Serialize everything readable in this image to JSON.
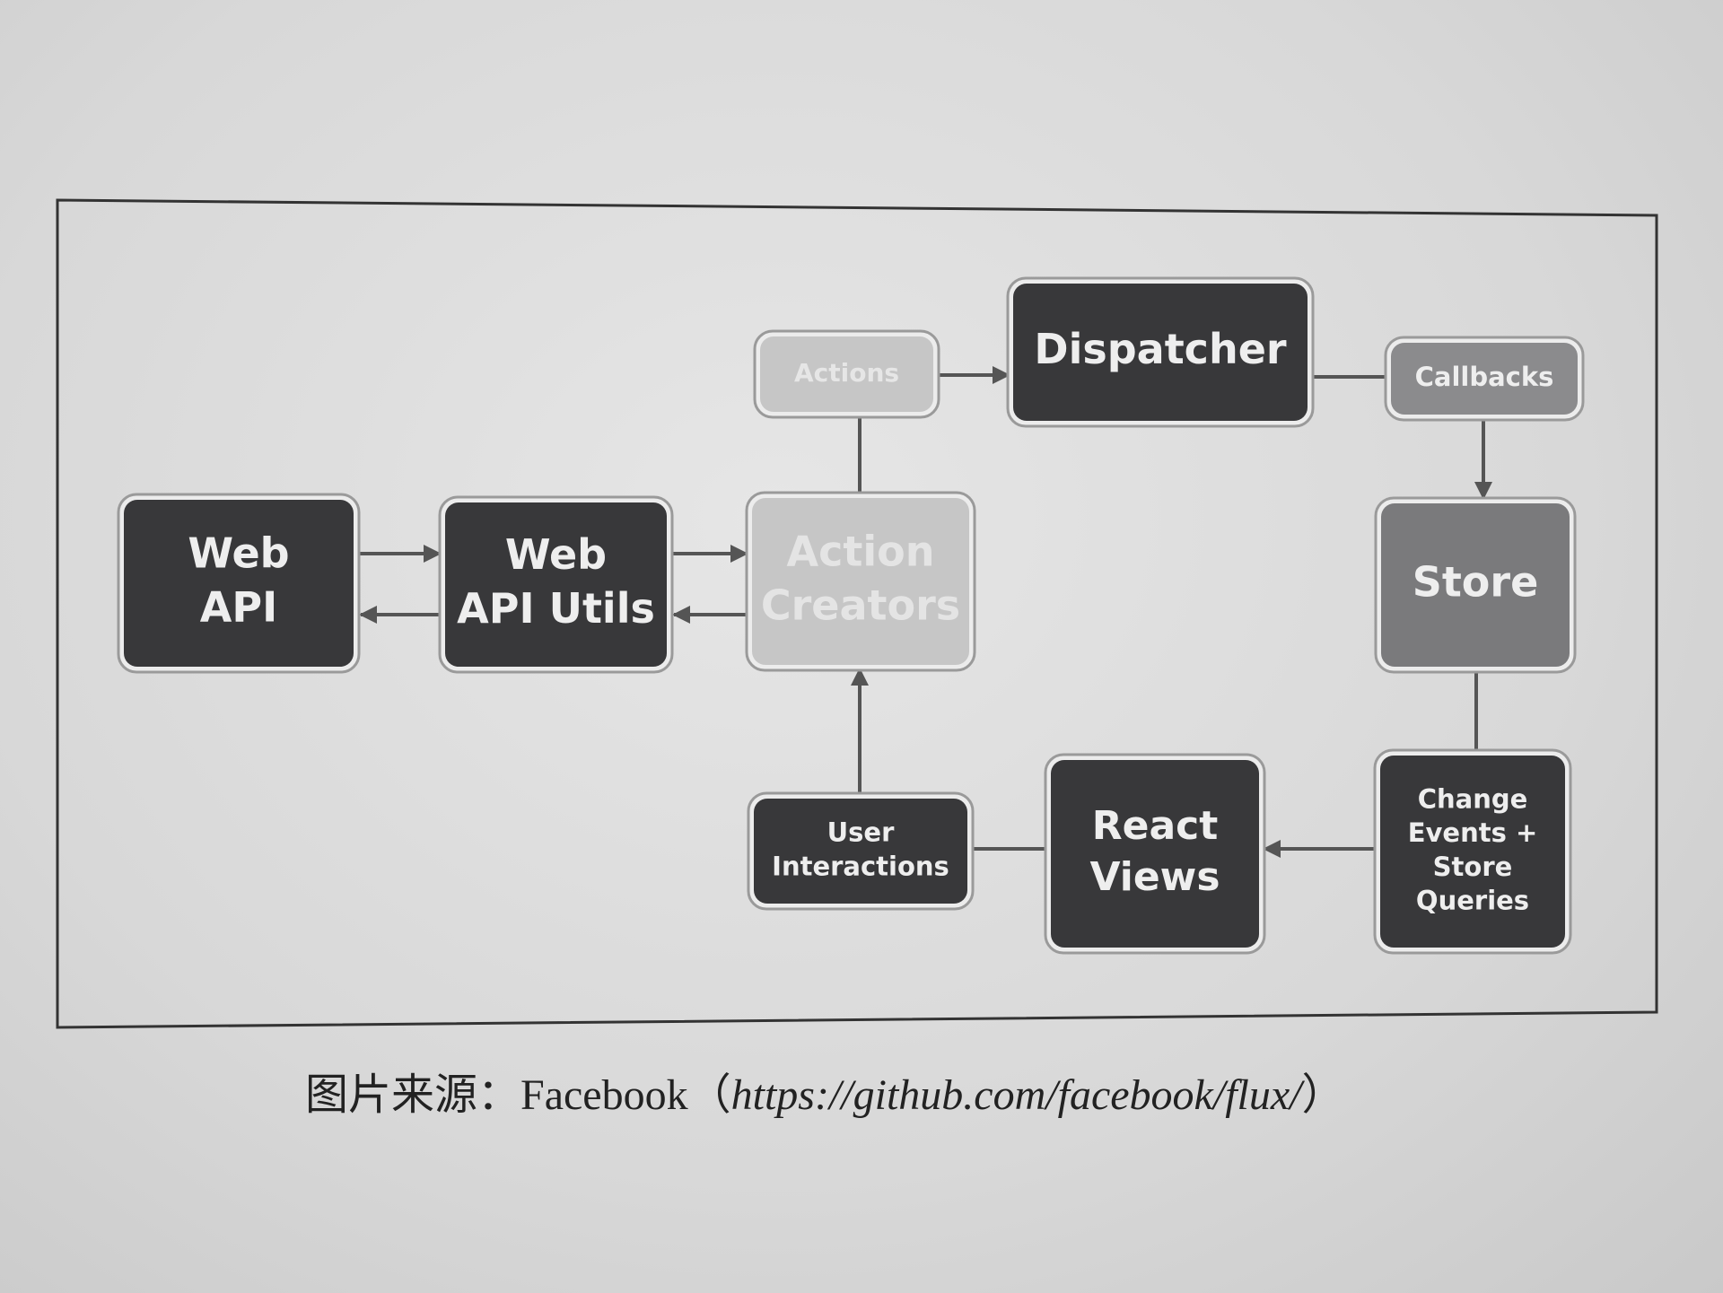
{
  "colors": {
    "dark": "#38383a",
    "medium": "#7a7a7c",
    "callbacks": "#8b8b8d",
    "light": "#c6c6c6",
    "border": "#9a9a9a",
    "halo": "#ececec",
    "line": "#555555"
  },
  "nodes": {
    "web_api": {
      "line1": "Web",
      "line2": "API"
    },
    "web_api_utils": {
      "line1": "Web",
      "line2": "API Utils"
    },
    "action_creators": {
      "line1": "Action",
      "line2": "Creators"
    },
    "actions": {
      "label": "Actions"
    },
    "dispatcher": {
      "label": "Dispatcher"
    },
    "callbacks": {
      "label": "Callbacks"
    },
    "store": {
      "label": "Store"
    },
    "change_events": {
      "line1": "Change",
      "line2": "Events +",
      "line3": "Store",
      "line4": "Queries"
    },
    "react_views": {
      "line1": "React",
      "line2": "Views"
    },
    "user_interactions": {
      "line1": "User",
      "line2": "Interactions"
    }
  },
  "caption": {
    "prefix": "图片来源：Facebook（",
    "url": "https://github.com/facebook/flux/",
    "suffix": "）"
  }
}
